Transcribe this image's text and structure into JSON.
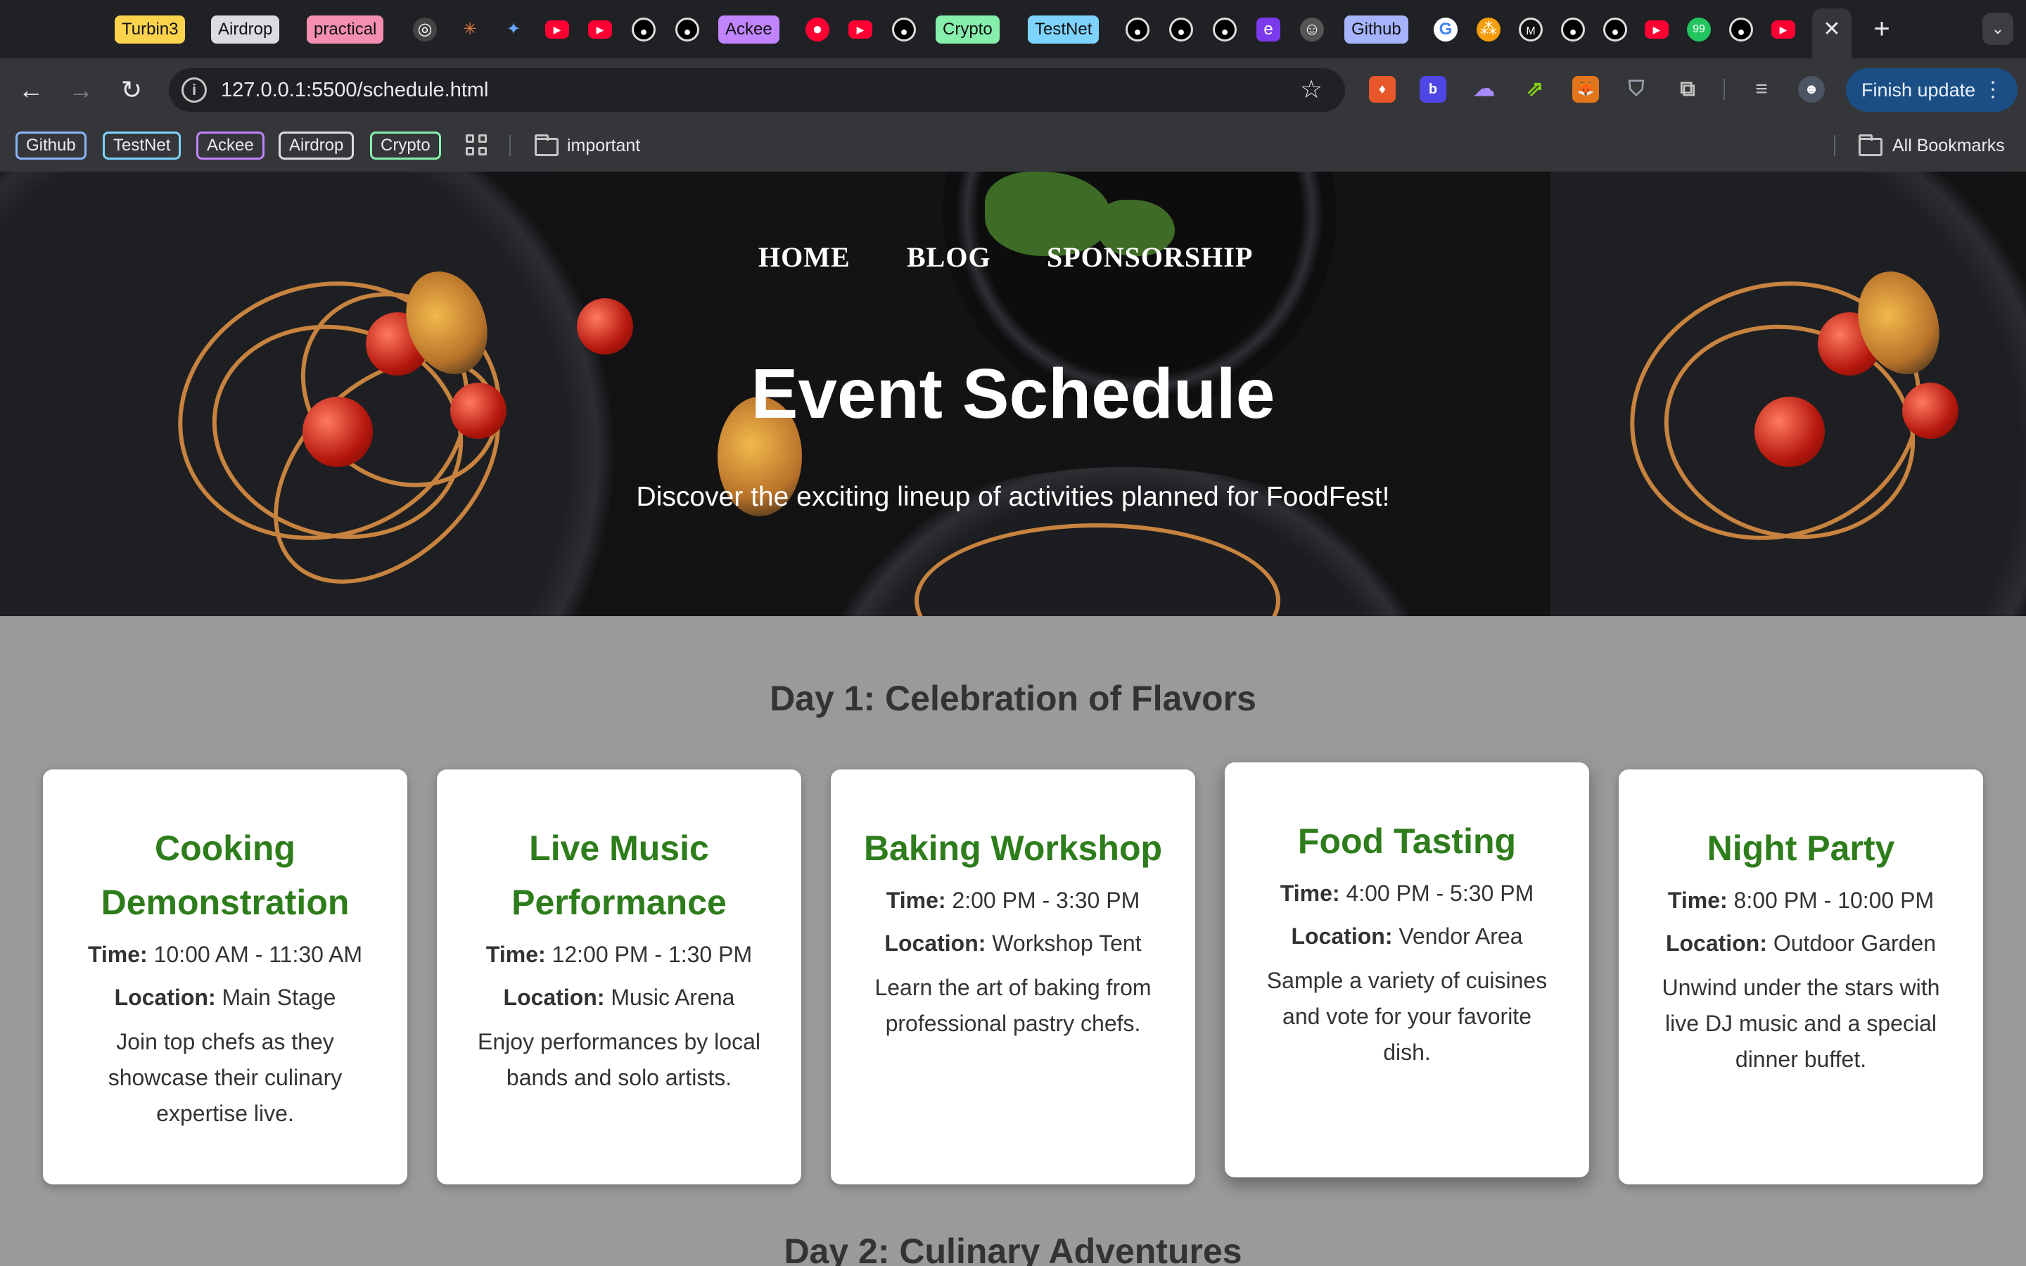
{
  "browser": {
    "tab_groups": [
      "Turbin3",
      "Airdrop",
      "practical",
      "Ackee",
      "Crypto",
      "TestNet",
      "Github"
    ],
    "url": "127.0.0.1:5500/schedule.html",
    "finish_update_label": "Finish update",
    "bookmarks": [
      "Github",
      "TestNet",
      "Ackee",
      "Airdrop",
      "Crypto"
    ],
    "bookmark_folder": "important",
    "all_bookmarks_label": "All Bookmarks"
  },
  "nav": {
    "home": "HOME",
    "blog": "BLOG",
    "sponsorship": "SPONSORSHIP"
  },
  "hero": {
    "title": "Event Schedule",
    "subtitle": "Discover the exciting lineup of activities planned for FoodFest!"
  },
  "labels": {
    "time": "Time:",
    "location": "Location:"
  },
  "day1": {
    "title": "Day 1: Celebration of Flavors",
    "events": [
      {
        "name": "Cooking Demonstration",
        "time": "10:00 AM - 11:30 AM",
        "location": "Main Stage",
        "description": "Join top chefs as they showcase their culinary expertise live."
      },
      {
        "name": "Live Music Performance",
        "time": "12:00 PM - 1:30 PM",
        "location": "Music Arena",
        "description": "Enjoy performances by local bands and solo artists."
      },
      {
        "name": "Baking Workshop",
        "time": "2:00 PM - 3:30 PM",
        "location": "Workshop Tent",
        "description": "Learn the art of baking from professional pastry chefs."
      },
      {
        "name": "Food Tasting",
        "time": "4:00 PM - 5:30 PM",
        "location": "Vendor Area",
        "description": "Sample a variety of cuisines and vote for your favorite dish."
      },
      {
        "name": "Night Party",
        "time": "8:00 PM - 10:00 PM",
        "location": "Outdoor Garden",
        "description": "Unwind under the stars with live DJ music and a special dinner buffet."
      }
    ]
  },
  "day2": {
    "title": "Day 2: Culinary Adventures"
  },
  "colors": {
    "card_title": "#2e7d1c",
    "page_background": "#9a9a9a",
    "hero_background": "#131313"
  }
}
